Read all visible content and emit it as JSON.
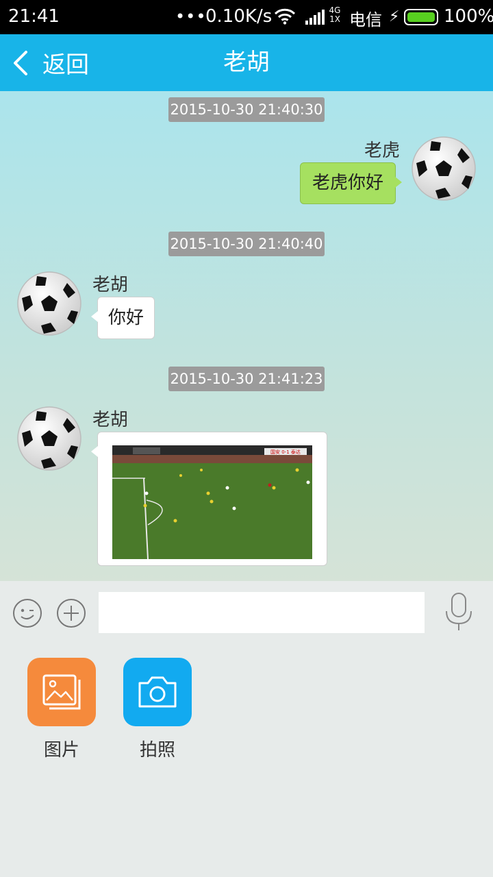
{
  "status_bar": {
    "time": "21:41",
    "dots": "•••",
    "network_speed": "0.10K/s",
    "network_type_top": "4G",
    "network_type_bottom": "1X",
    "carrier": "电信",
    "battery_percent": "100%",
    "battery_level": 1.0
  },
  "header": {
    "back_label": "返回",
    "title": "老胡"
  },
  "messages": [
    {
      "timestamp": "2015-10-30 21:40:30",
      "sender": "老虎",
      "side": "right",
      "type": "text",
      "text": "老虎你好"
    },
    {
      "timestamp": "2015-10-30 21:40:40",
      "sender": "老胡",
      "side": "left",
      "type": "text",
      "text": "你好"
    },
    {
      "timestamp": "2015-10-30 21:41:23",
      "sender": "老胡",
      "side": "left",
      "type": "image",
      "scoreboard": "国安 0-1 泰达"
    }
  ],
  "input_bar": {
    "placeholder": "",
    "emoji_icon": "smiley-icon",
    "plus_icon": "plus-circle-icon",
    "voice_icon": "microphone-icon"
  },
  "plus_panel": {
    "items": [
      {
        "label": "图片",
        "icon": "picture-icon",
        "color": "#f58a3c"
      },
      {
        "label": "拍照",
        "icon": "camera-icon",
        "color": "#12aaf0"
      }
    ]
  },
  "colors": {
    "title_bar": "#18b4e8",
    "my_bubble": "#a6e060",
    "timestamp_bg": "#9b9b9b"
  }
}
